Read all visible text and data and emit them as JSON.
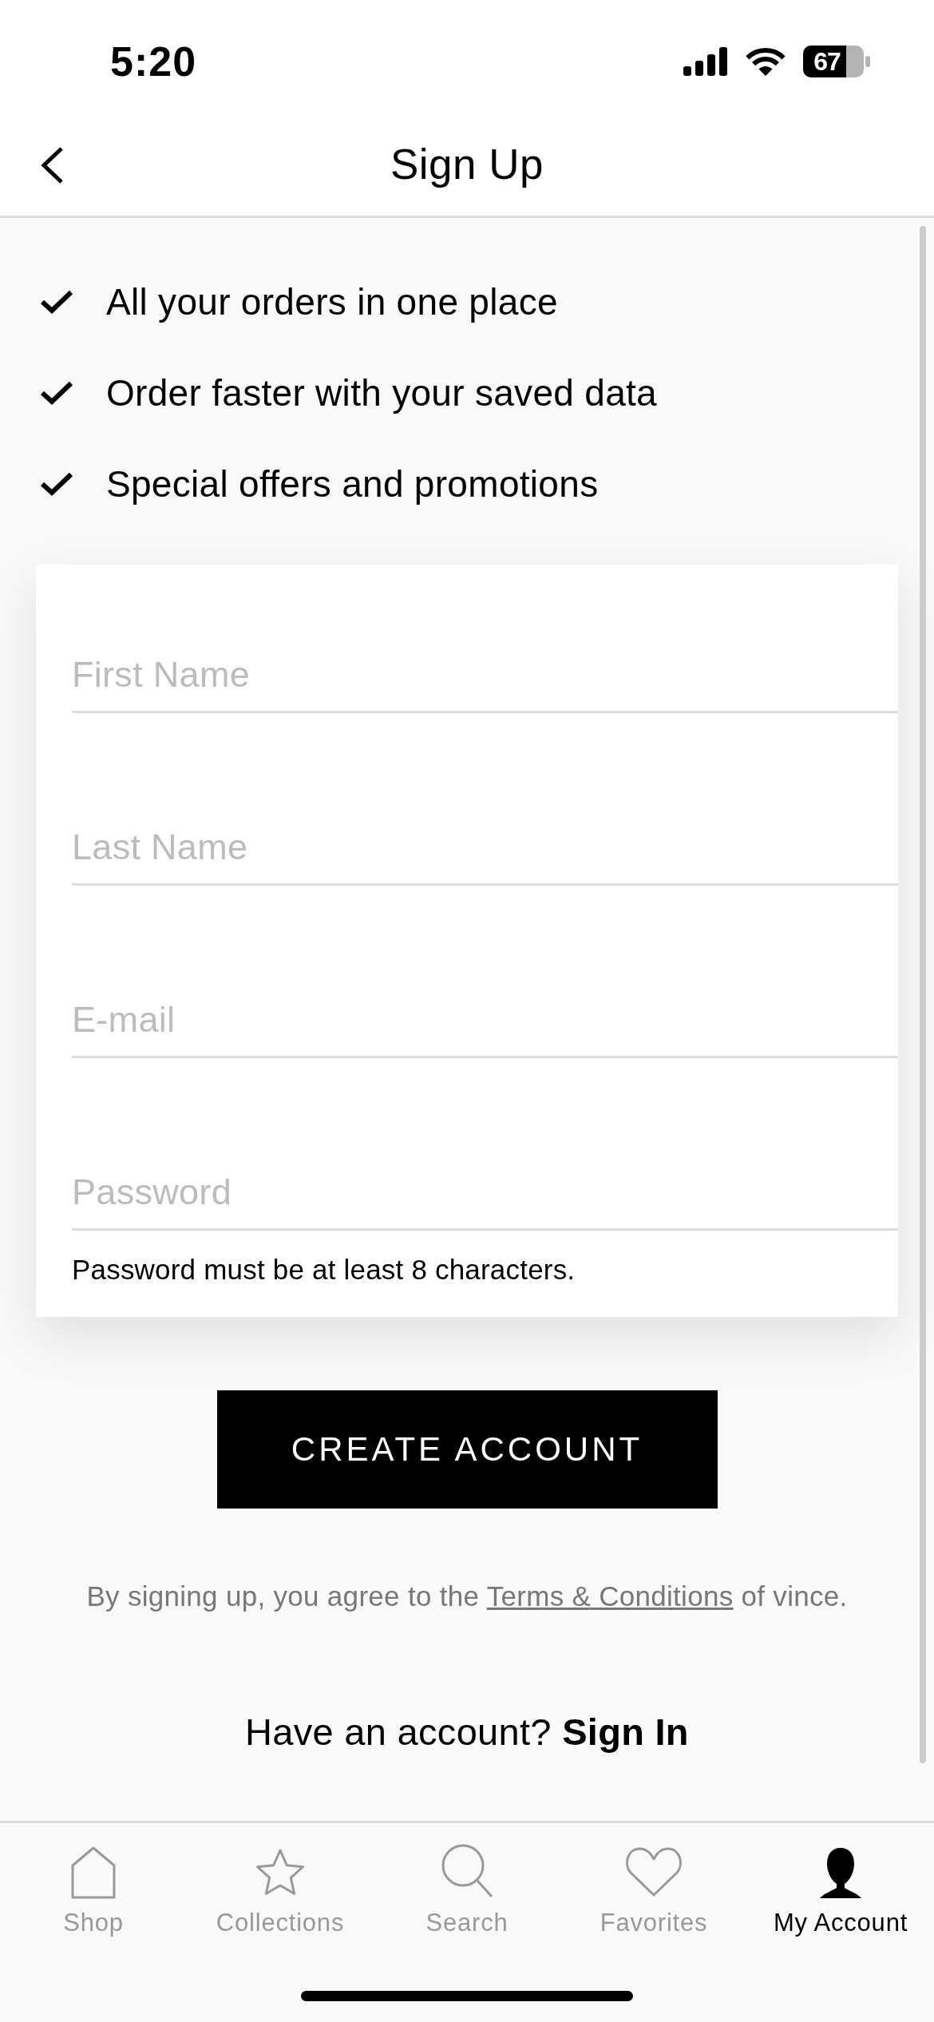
{
  "status_bar": {
    "time": "5:20",
    "battery": "67"
  },
  "header": {
    "title": "Sign Up"
  },
  "benefits": [
    {
      "text": "All your orders in one place"
    },
    {
      "text": "Order faster with your saved data"
    },
    {
      "text": "Special offers and promotions"
    }
  ],
  "form": {
    "fields": [
      {
        "placeholder": "First Name"
      },
      {
        "placeholder": "Last Name"
      },
      {
        "placeholder": "E-mail"
      },
      {
        "placeholder": "Password"
      }
    ],
    "password_hint": "Password must be at least 8 characters."
  },
  "create_button": "CREATE ACCOUNT",
  "terms": {
    "before": "By signing up, you agree to the",
    "link": "Terms & Conditions",
    "after": "of vince."
  },
  "sign_in": {
    "prompt": "Have an account?",
    "link": "Sign In"
  },
  "tab_bar": [
    {
      "label": "Shop",
      "selected": false
    },
    {
      "label": "Collections",
      "selected": false
    },
    {
      "label": "Search",
      "selected": false
    },
    {
      "label": "Favorites",
      "selected": false
    },
    {
      "label": "My Account",
      "selected": true
    }
  ]
}
